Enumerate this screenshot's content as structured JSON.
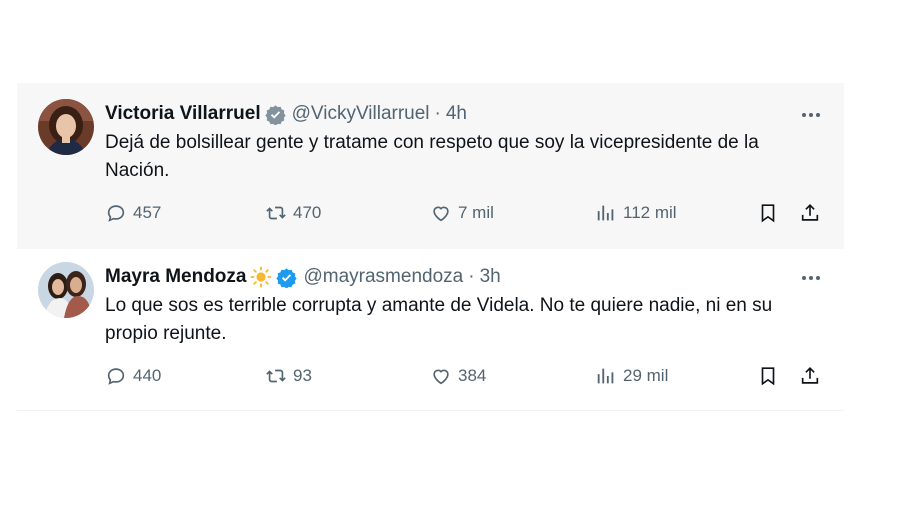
{
  "tweets": [
    {
      "author_name": "Victoria Villarruel",
      "handle": "@VickyVillarruel",
      "separator": "·",
      "time": "4h",
      "text": "Dejá de bolsillear gente y tratame con respeto que soy la vicepresidente de la Nación.",
      "replies": "457",
      "retweets": "470",
      "likes": "7 mil",
      "views": "112 mil"
    },
    {
      "author_name": "Mayra Mendoza",
      "handle": "@mayrasmendoza",
      "separator": "·",
      "time": "3h",
      "text": "Lo que sos es terrible corrupta y amante de Videla. No te quiere nadie, ni en su propio rejunte.",
      "replies": "440",
      "retweets": "93",
      "likes": "384",
      "views": "29 mil"
    }
  ],
  "icons": {
    "verified": "verified-badge-icon",
    "sun": "sun-emoji-icon",
    "reply": "reply-icon",
    "retweet": "retweet-icon",
    "like": "heart-icon",
    "views": "views-chart-icon",
    "bookmark": "bookmark-icon",
    "share": "share-icon",
    "more": "more-options-icon"
  },
  "colors": {
    "verified_blue": "#1d9bf0",
    "secondary_text": "#536471",
    "primary_text": "#0f1419",
    "highlight_bg": "#f7f7f7"
  }
}
